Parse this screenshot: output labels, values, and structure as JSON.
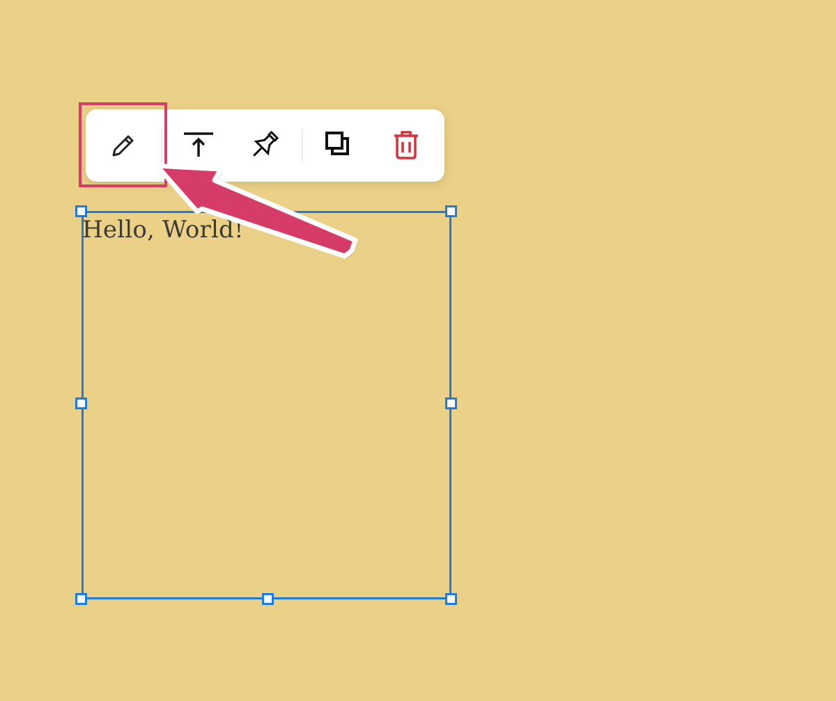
{
  "note": {
    "text": "Hello, World!",
    "background_color": "#ebd188"
  },
  "toolbar": {
    "buttons": [
      {
        "name": "edit",
        "icon": "pencil-icon"
      },
      {
        "name": "bring-to-front",
        "icon": "arrow-up-to-line-icon"
      },
      {
        "name": "pin",
        "icon": "pushpin-icon"
      },
      {
        "name": "duplicate",
        "icon": "copy-icon"
      },
      {
        "name": "delete",
        "icon": "trash-icon",
        "color": "#d8303a"
      }
    ]
  },
  "colors": {
    "selection": "#1e7be0",
    "annotation": "#d63c68",
    "delete": "#d8303a"
  }
}
